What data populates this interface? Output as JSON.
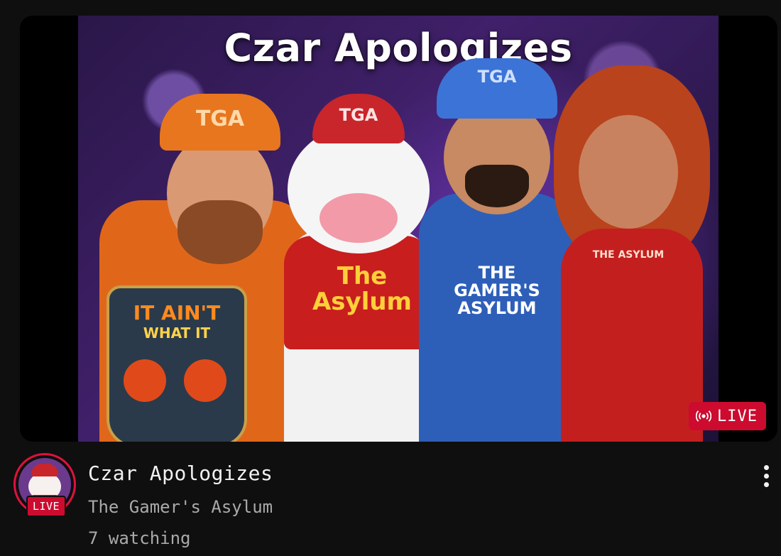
{
  "video": {
    "thumbnail": {
      "title_text": "Czar Apologizes",
      "caps": [
        "TGA",
        "TGA",
        "TGA"
      ],
      "shirt_asylum": "The Asylum",
      "shirt_gamers": "THE GAMER'S ASYLUM",
      "shirt_small": "THE ASYLUM",
      "logo_line1": "IT AIN'T",
      "logo_line2": "WHAT IT"
    },
    "live_label": "LIVE",
    "title": "Czar Apologizes",
    "channel": "The Gamer's Asylum",
    "watching": "7 watching"
  },
  "avatar": {
    "live_label": "LIVE"
  },
  "colors": {
    "live_red": "#cc0b2f",
    "background": "#0f0f0f",
    "secondary_text": "#aaaaaa"
  }
}
